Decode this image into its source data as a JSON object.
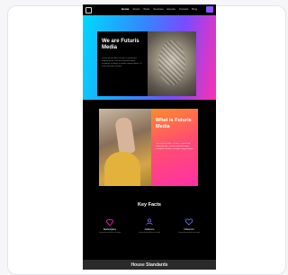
{
  "nav": {
    "links": [
      "Home",
      "About",
      "Work",
      "Services",
      "Events",
      "Contact",
      "Blog"
    ],
    "cta_icon": "menu-icon"
  },
  "hero": {
    "title": "We are Futuris Media",
    "description": "Lorem ipsum dolor sit amet, consectetur adipiscing elit, sed do eiusmod tempor incididunt ut labore et dolore magna aliqua. Ut enim ad minim veniam."
  },
  "section2": {
    "title": "What is Futuris Media",
    "description": "Lorem ipsum dolor sit amet, consectetur adipiscing elit, sed do eiusmod tempor incididunt ut labore et dolore magna aliqua."
  },
  "key_facts": {
    "title": "Key Facts",
    "items": [
      {
        "label": "Marketplace",
        "sub": "Lorem ipsum dolor sit amet",
        "icon": "diamond-icon",
        "color": "#ff2fb0"
      },
      {
        "label": "Audience",
        "sub": "Lorem ipsum dolor sit amet",
        "icon": "people-icon",
        "color": "#8a5bff"
      },
      {
        "label": "Influencer",
        "sub": "Lorem ipsum dolor sit amet",
        "icon": "heart-icon",
        "color": "#6b7bff"
      }
    ]
  },
  "bottom": {
    "title": "House Standards"
  }
}
